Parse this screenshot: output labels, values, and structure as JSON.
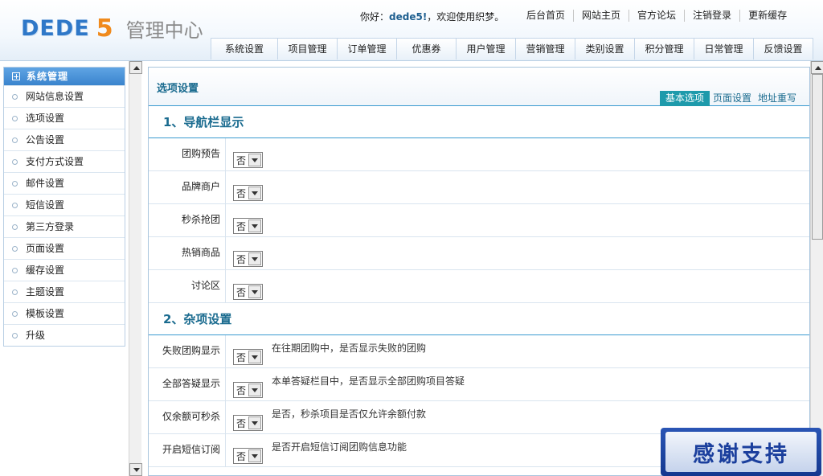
{
  "header": {
    "logo_main": "DEDE",
    "logo_number": "5",
    "logo_subtitle": "管理中心",
    "greeting_prefix": "你好：",
    "greeting_user": "dede5!",
    "greeting_suffix": "，欢迎使用织梦。",
    "top_links": [
      "后台首页",
      "网站主页",
      "官方论坛",
      "注销登录",
      "更新缓存"
    ],
    "nav_tabs": [
      "系统设置",
      "项目管理",
      "订单管理",
      "优惠券",
      "用户管理",
      "营销管理",
      "类别设置",
      "积分管理",
      "日常管理",
      "反馈设置"
    ]
  },
  "sidebar": {
    "title": "系统管理",
    "items": [
      "网站信息设置",
      "选项设置",
      "公告设置",
      "支付方式设置",
      "邮件设置",
      "短信设置",
      "第三方登录",
      "页面设置",
      "缓存设置",
      "主题设置",
      "模板设置",
      "升级"
    ]
  },
  "main": {
    "title": "选项设置",
    "subtabs": [
      "基本选项",
      "页面设置",
      "地址重写"
    ],
    "section1": {
      "title": "1、导航栏显示",
      "rows": [
        {
          "label": "团购预告",
          "value": "否"
        },
        {
          "label": "品牌商户",
          "value": "否"
        },
        {
          "label": "秒杀抢团",
          "value": "否"
        },
        {
          "label": "热销商品",
          "value": "否"
        },
        {
          "label": "讨论区",
          "value": "否"
        }
      ]
    },
    "section2": {
      "title": "2、杂项设置",
      "rows": [
        {
          "label": "失败团购显示",
          "value": "否",
          "desc": "在往期团购中，是否显示失败的团购"
        },
        {
          "label": "全部答疑显示",
          "value": "否",
          "desc": "本单答疑栏目中，是否显示全部团购项目答疑"
        },
        {
          "label": "仅余额可秒杀",
          "value": "否",
          "desc": "是否，秒杀项目是否仅允许余额付款"
        },
        {
          "label": "开启短信订阅",
          "value": "否",
          "desc": "是否开启短信订阅团购信息功能"
        }
      ]
    }
  },
  "badge": {
    "text": "感谢支持"
  }
}
